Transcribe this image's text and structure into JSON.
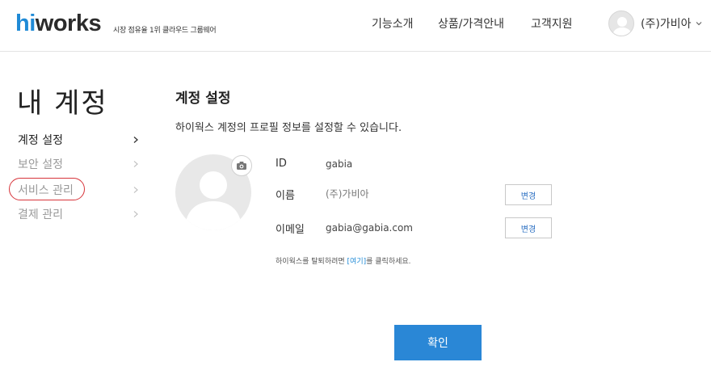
{
  "header": {
    "logo_hi": "hi",
    "logo_works": "works",
    "logo_tagline": "시장 점유율 1위 클라우드 그룹웨어",
    "nav": [
      "기능소개",
      "상품/가격안내",
      "고객지원"
    ],
    "user_name": "(주)가비아",
    "brand_color": "#1f8ad6"
  },
  "sidebar": {
    "title": "내 계정",
    "items": [
      {
        "label": "계정 설정",
        "active": true
      },
      {
        "label": "보안 설정",
        "active": false
      },
      {
        "label": "서비스 관리",
        "active": false,
        "highlighted": true
      },
      {
        "label": "결제 관리",
        "active": false
      }
    ],
    "highlight_color": "#d7343a"
  },
  "main": {
    "title": "계정 설정",
    "description": "하이웍스 계정의 프로필 정보를 설정할 수 있습니다.",
    "fields": {
      "id": {
        "label": "ID",
        "value": "gabia"
      },
      "name": {
        "label": "이름",
        "value": "(주)가비아",
        "button": "변경"
      },
      "email": {
        "label": "이메일",
        "value": "gabia@gabia.com",
        "button": "변경"
      }
    },
    "withdraw_prefix": "하이웍스를 탈퇴하려면 ",
    "withdraw_link": "[여기]",
    "withdraw_suffix": "를 클릭하세요.",
    "confirm_button": "확인",
    "confirm_color": "#2a87d6"
  },
  "icons": {
    "camera": "camera-icon",
    "avatar": "user-silhouette-icon",
    "chevron": "chevron-right-icon",
    "caret": "chevron-down-icon"
  }
}
